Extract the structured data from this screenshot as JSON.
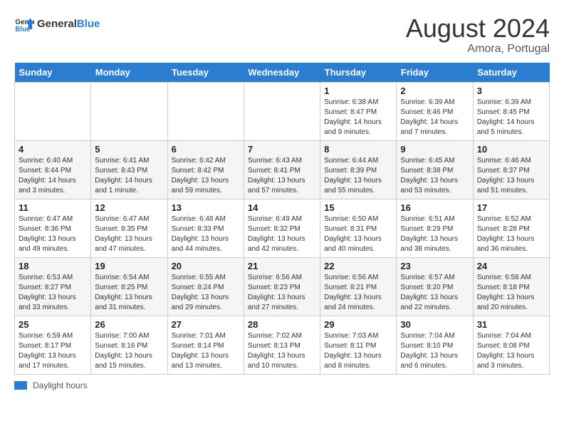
{
  "header": {
    "logo_general": "General",
    "logo_blue": "Blue",
    "month_year": "August 2024",
    "location": "Amora, Portugal"
  },
  "weekdays": [
    "Sunday",
    "Monday",
    "Tuesday",
    "Wednesday",
    "Thursday",
    "Friday",
    "Saturday"
  ],
  "weeks": [
    [
      {
        "day": "",
        "info": ""
      },
      {
        "day": "",
        "info": ""
      },
      {
        "day": "",
        "info": ""
      },
      {
        "day": "",
        "info": ""
      },
      {
        "day": "1",
        "info": "Sunrise: 6:38 AM\nSunset: 8:47 PM\nDaylight: 14 hours and 9 minutes."
      },
      {
        "day": "2",
        "info": "Sunrise: 6:39 AM\nSunset: 8:46 PM\nDaylight: 14 hours and 7 minutes."
      },
      {
        "day": "3",
        "info": "Sunrise: 6:39 AM\nSunset: 8:45 PM\nDaylight: 14 hours and 5 minutes."
      }
    ],
    [
      {
        "day": "4",
        "info": "Sunrise: 6:40 AM\nSunset: 8:44 PM\nDaylight: 14 hours and 3 minutes."
      },
      {
        "day": "5",
        "info": "Sunrise: 6:41 AM\nSunset: 8:43 PM\nDaylight: 14 hours and 1 minute."
      },
      {
        "day": "6",
        "info": "Sunrise: 6:42 AM\nSunset: 8:42 PM\nDaylight: 13 hours and 59 minutes."
      },
      {
        "day": "7",
        "info": "Sunrise: 6:43 AM\nSunset: 8:41 PM\nDaylight: 13 hours and 57 minutes."
      },
      {
        "day": "8",
        "info": "Sunrise: 6:44 AM\nSunset: 8:39 PM\nDaylight: 13 hours and 55 minutes."
      },
      {
        "day": "9",
        "info": "Sunrise: 6:45 AM\nSunset: 8:38 PM\nDaylight: 13 hours and 53 minutes."
      },
      {
        "day": "10",
        "info": "Sunrise: 6:46 AM\nSunset: 8:37 PM\nDaylight: 13 hours and 51 minutes."
      }
    ],
    [
      {
        "day": "11",
        "info": "Sunrise: 6:47 AM\nSunset: 8:36 PM\nDaylight: 13 hours and 49 minutes."
      },
      {
        "day": "12",
        "info": "Sunrise: 6:47 AM\nSunset: 8:35 PM\nDaylight: 13 hours and 47 minutes."
      },
      {
        "day": "13",
        "info": "Sunrise: 6:48 AM\nSunset: 8:33 PM\nDaylight: 13 hours and 44 minutes."
      },
      {
        "day": "14",
        "info": "Sunrise: 6:49 AM\nSunset: 8:32 PM\nDaylight: 13 hours and 42 minutes."
      },
      {
        "day": "15",
        "info": "Sunrise: 6:50 AM\nSunset: 8:31 PM\nDaylight: 13 hours and 40 minutes."
      },
      {
        "day": "16",
        "info": "Sunrise: 6:51 AM\nSunset: 8:29 PM\nDaylight: 13 hours and 38 minutes."
      },
      {
        "day": "17",
        "info": "Sunrise: 6:52 AM\nSunset: 8:28 PM\nDaylight: 13 hours and 36 minutes."
      }
    ],
    [
      {
        "day": "18",
        "info": "Sunrise: 6:53 AM\nSunset: 8:27 PM\nDaylight: 13 hours and 33 minutes."
      },
      {
        "day": "19",
        "info": "Sunrise: 6:54 AM\nSunset: 8:25 PM\nDaylight: 13 hours and 31 minutes."
      },
      {
        "day": "20",
        "info": "Sunrise: 6:55 AM\nSunset: 8:24 PM\nDaylight: 13 hours and 29 minutes."
      },
      {
        "day": "21",
        "info": "Sunrise: 6:56 AM\nSunset: 8:23 PM\nDaylight: 13 hours and 27 minutes."
      },
      {
        "day": "22",
        "info": "Sunrise: 6:56 AM\nSunset: 8:21 PM\nDaylight: 13 hours and 24 minutes."
      },
      {
        "day": "23",
        "info": "Sunrise: 6:57 AM\nSunset: 8:20 PM\nDaylight: 13 hours and 22 minutes."
      },
      {
        "day": "24",
        "info": "Sunrise: 6:58 AM\nSunset: 8:18 PM\nDaylight: 13 hours and 20 minutes."
      }
    ],
    [
      {
        "day": "25",
        "info": "Sunrise: 6:59 AM\nSunset: 8:17 PM\nDaylight: 13 hours and 17 minutes."
      },
      {
        "day": "26",
        "info": "Sunrise: 7:00 AM\nSunset: 8:16 PM\nDaylight: 13 hours and 15 minutes."
      },
      {
        "day": "27",
        "info": "Sunrise: 7:01 AM\nSunset: 8:14 PM\nDaylight: 13 hours and 13 minutes."
      },
      {
        "day": "28",
        "info": "Sunrise: 7:02 AM\nSunset: 8:13 PM\nDaylight: 13 hours and 10 minutes."
      },
      {
        "day": "29",
        "info": "Sunrise: 7:03 AM\nSunset: 8:11 PM\nDaylight: 13 hours and 8 minutes."
      },
      {
        "day": "30",
        "info": "Sunrise: 7:04 AM\nSunset: 8:10 PM\nDaylight: 13 hours and 6 minutes."
      },
      {
        "day": "31",
        "info": "Sunrise: 7:04 AM\nSunset: 8:08 PM\nDaylight: 13 hours and 3 minutes."
      }
    ]
  ],
  "legend": {
    "label": "Daylight hours"
  }
}
